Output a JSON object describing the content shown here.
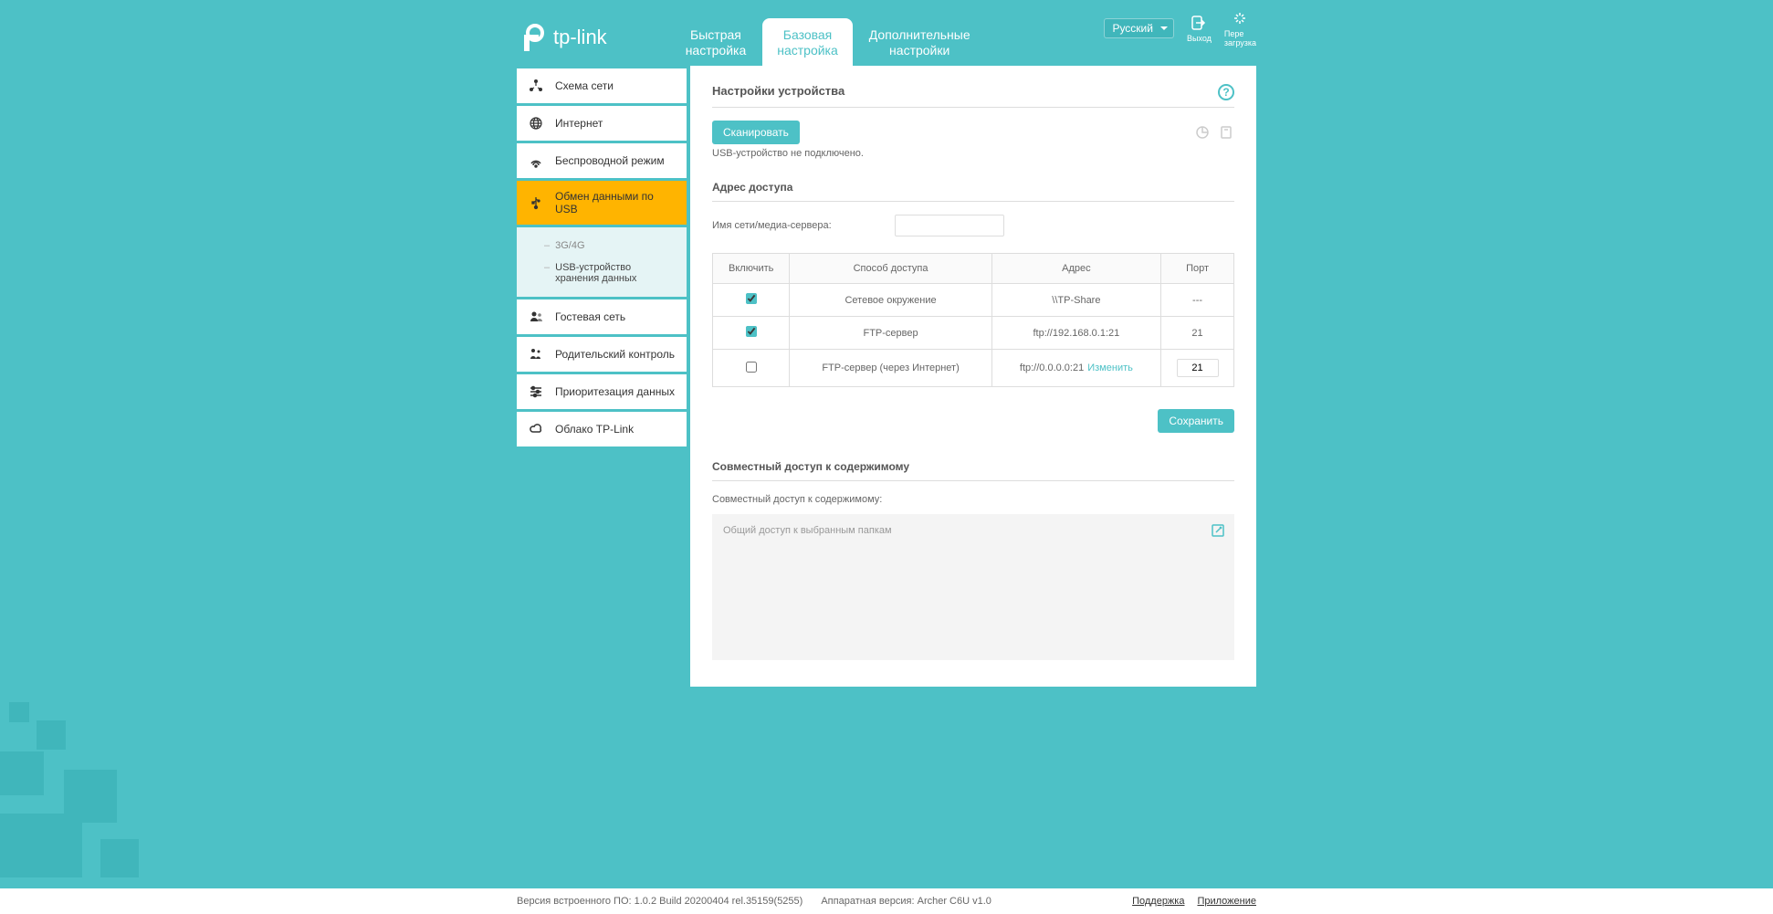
{
  "header": {
    "logo_text": "tp-link",
    "tabs": [
      {
        "line1": "Быстрая",
        "line2": "настройка"
      },
      {
        "line1": "Базовая",
        "line2": "настройка"
      },
      {
        "line1": "Дополнительные",
        "line2": "настройки"
      }
    ],
    "logout": "Выход",
    "reboot": {
      "line1": "Пере",
      "line2": "загрузка"
    },
    "language": "Русский"
  },
  "sidebar": {
    "items": [
      {
        "label": "Схема сети"
      },
      {
        "label": "Интернет"
      },
      {
        "label": "Беспроводной режим"
      },
      {
        "label": "Обмен данными по USB"
      },
      {
        "label": "Гостевая сеть"
      },
      {
        "label": "Родительский контроль"
      },
      {
        "label": "Приоритезация данных"
      },
      {
        "label": "Облако TP-Link"
      }
    ],
    "sub": [
      {
        "label": "3G/4G"
      },
      {
        "label": "USB-устройство хранения данных"
      }
    ]
  },
  "content": {
    "device_settings_title": "Настройки устройства",
    "scan_btn": "Сканировать",
    "usb_status": "USB-устройство не подключено.",
    "access_title": "Адрес доступа",
    "server_name_label": "Имя сети/медиа-сервера:",
    "server_name_value": "",
    "table": {
      "headers": [
        "Включить",
        "Способ доступа",
        "Адрес",
        "Порт"
      ],
      "rows": [
        {
          "enabled": true,
          "method": "Сетевое окружение",
          "address": "\\\\TP-Share",
          "port": "---"
        },
        {
          "enabled": true,
          "method": "FTP-сервер",
          "address": "ftp://192.168.0.1:21",
          "port": "21"
        },
        {
          "enabled": false,
          "method": "FTP-сервер (через Интернет)",
          "address": "ftp://0.0.0.0:21",
          "change": "Изменить",
          "port_input": "21"
        }
      ]
    },
    "save_btn": "Сохранить",
    "sharing_title": "Совместный доступ к содержимому",
    "sharing_label": "Совместный доступ к содержимому:",
    "sharing_box": "Общий доступ к выбранным папкам"
  },
  "footer": {
    "firmware": "Версия встроенного ПО: 1.0.2 Build 20200404 rel.35159(5255)",
    "hardware": "Аппаратная версия: Archer C6U v1.0",
    "support": "Поддержка",
    "app": "Приложение"
  }
}
